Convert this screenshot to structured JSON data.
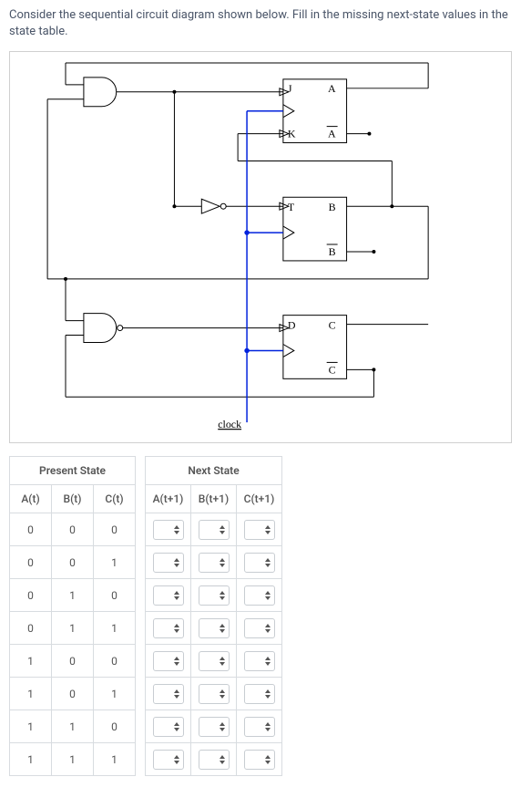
{
  "question_text": "Consider the sequential circuit diagram shown below. Fill in the missing next-state values in the state table.",
  "diagram": {
    "ff_a": {
      "input1": "J",
      "input2": "K",
      "out": "A",
      "out_bar": "A̅"
    },
    "ff_b": {
      "input1": "T",
      "out": "B",
      "out_bar": "B̅"
    },
    "ff_c": {
      "input1": "D",
      "out": "C",
      "out_bar": "C̅"
    },
    "clock_label": "clock"
  },
  "tables": {
    "present_header": "Present State",
    "next_header": "Next State",
    "present_cols": [
      "A(t)",
      "B(t)",
      "C(t)"
    ],
    "next_cols": [
      "A(t+1)",
      "B(t+1)",
      "C(t+1)"
    ],
    "rows": [
      {
        "p": [
          "0",
          "0",
          "0"
        ]
      },
      {
        "p": [
          "0",
          "0",
          "1"
        ]
      },
      {
        "p": [
          "0",
          "1",
          "0"
        ]
      },
      {
        "p": [
          "0",
          "1",
          "1"
        ]
      },
      {
        "p": [
          "1",
          "0",
          "0"
        ]
      },
      {
        "p": [
          "1",
          "0",
          "1"
        ]
      },
      {
        "p": [
          "1",
          "1",
          "0"
        ]
      },
      {
        "p": [
          "1",
          "1",
          "1"
        ]
      }
    ]
  },
  "chart_data": {
    "type": "table",
    "title": "Sequential circuit state table (next-state values to be filled in)",
    "columns": [
      "A(t)",
      "B(t)",
      "C(t)",
      "A(t+1)",
      "B(t+1)",
      "C(t+1)"
    ],
    "rows": [
      [
        "0",
        "0",
        "0",
        null,
        null,
        null
      ],
      [
        "0",
        "0",
        "1",
        null,
        null,
        null
      ],
      [
        "0",
        "1",
        "0",
        null,
        null,
        null
      ],
      [
        "0",
        "1",
        "1",
        null,
        null,
        null
      ],
      [
        "1",
        "0",
        "0",
        null,
        null,
        null
      ],
      [
        "1",
        "0",
        "1",
        null,
        null,
        null
      ],
      [
        "1",
        "1",
        "0",
        null,
        null,
        null
      ],
      [
        "1",
        "1",
        "1",
        null,
        null,
        null
      ]
    ],
    "circuit": {
      "flipflops": [
        {
          "name": "A",
          "type": "JK",
          "inputs": [
            "J",
            "K"
          ],
          "outputs": [
            "A",
            "A'"
          ]
        },
        {
          "name": "B",
          "type": "T",
          "inputs": [
            "T"
          ],
          "outputs": [
            "B",
            "B'"
          ]
        },
        {
          "name": "C",
          "type": "D",
          "inputs": [
            "D"
          ],
          "outputs": [
            "C",
            "C'"
          ]
        }
      ],
      "gates": [
        "AND (2-input, feeds J of A)",
        "NOT (inverter on clock-adjacent line feeding T of B)",
        "AND (2-input, feeds D of C)"
      ],
      "clock": "shared clock line to all three flip-flops"
    }
  }
}
